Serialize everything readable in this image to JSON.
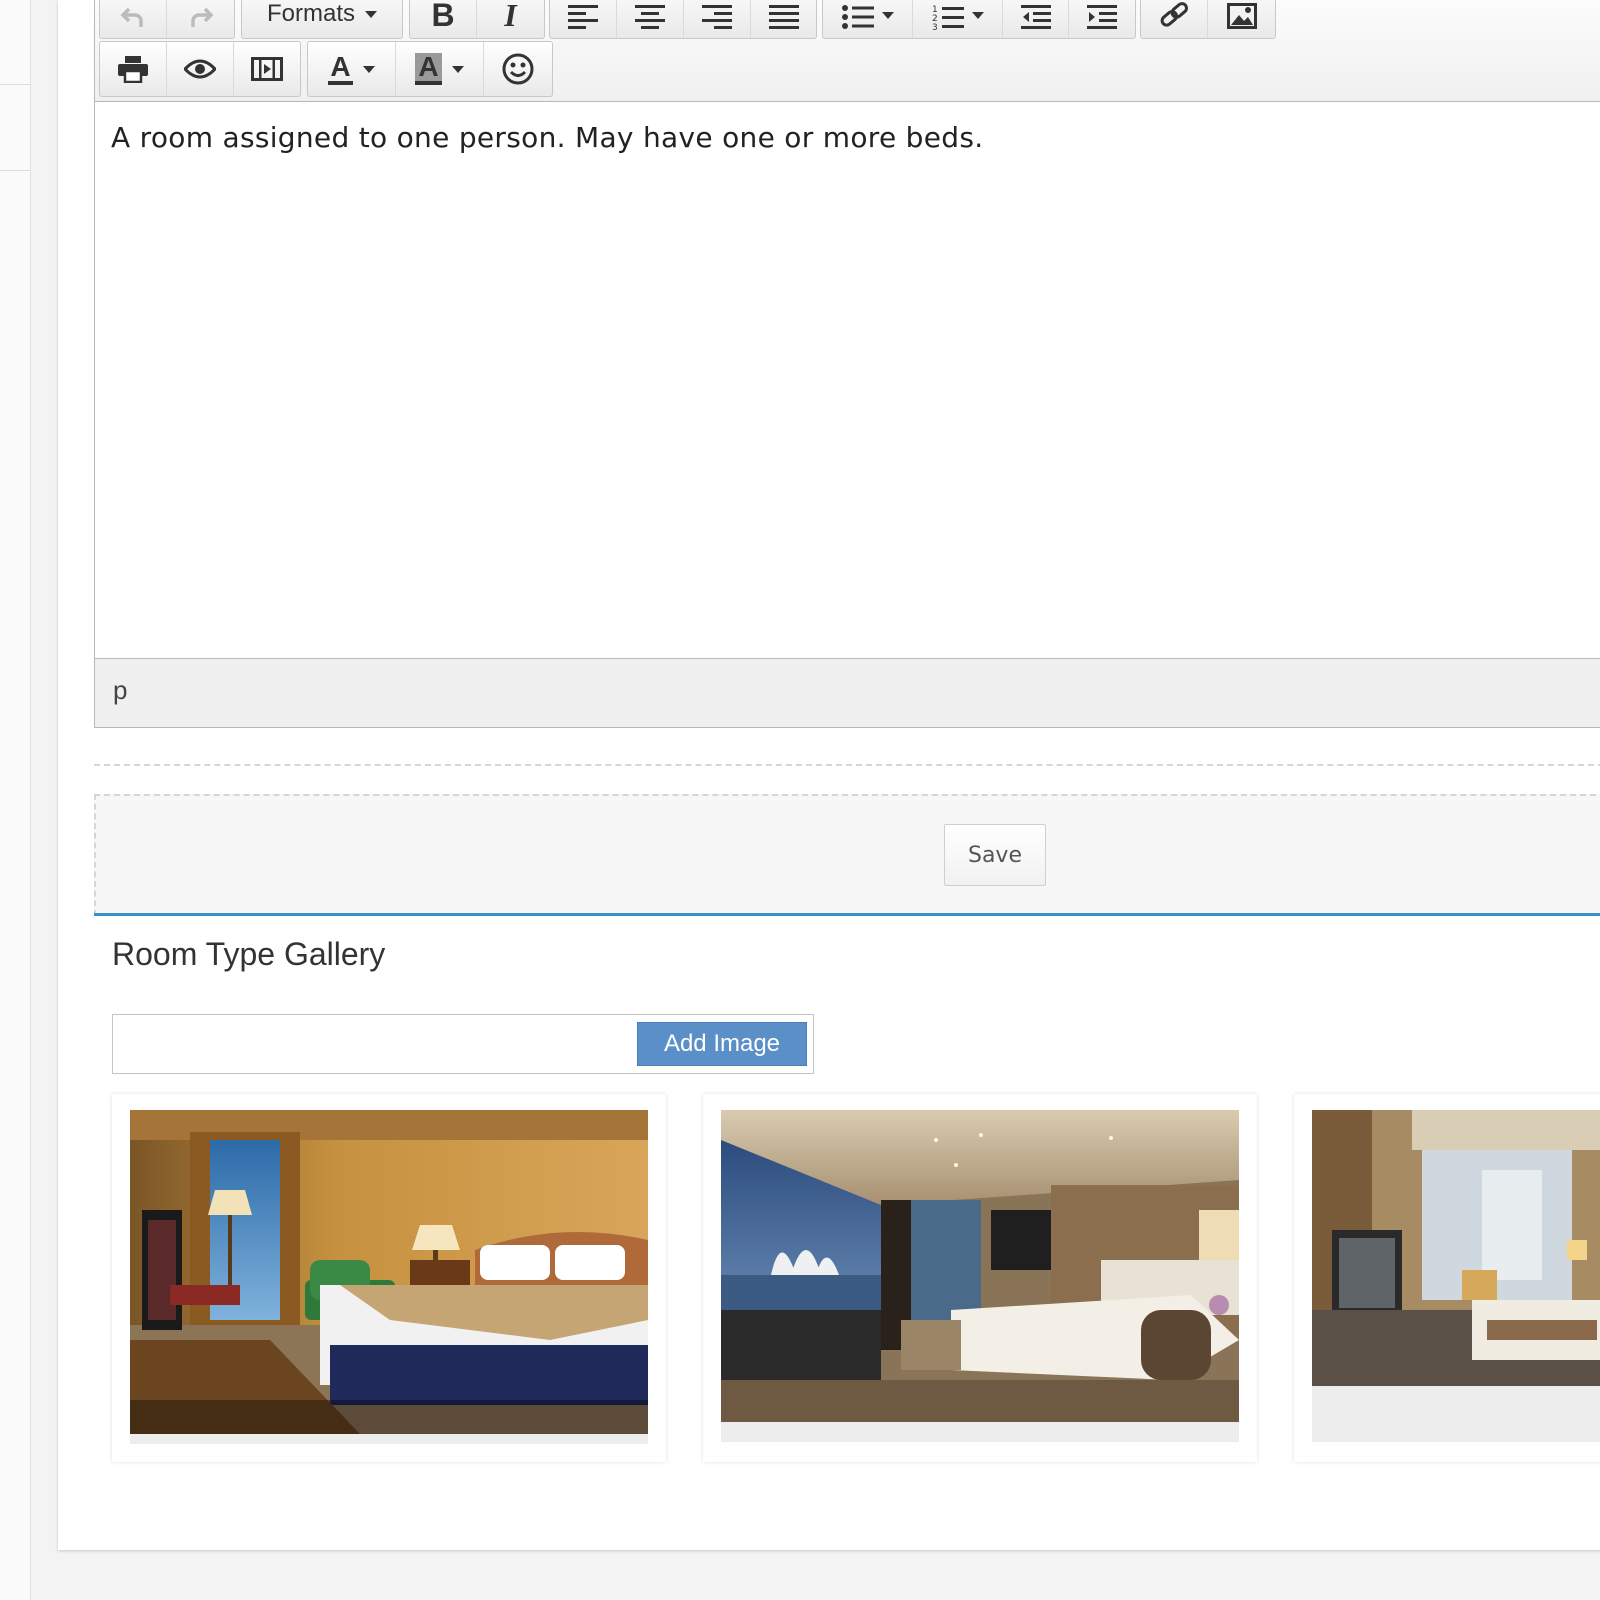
{
  "toolbar": {
    "undo": "undo-icon",
    "redo": "redo-icon",
    "formats_label": "Formats",
    "bold_label": "B",
    "italic_label": "I",
    "text_color_label": "A",
    "bg_color_label": "A"
  },
  "editor": {
    "content": "A room assigned to one person. May have one or more beds.",
    "path": "p"
  },
  "actions": {
    "save_label": "Save"
  },
  "gallery": {
    "title": "Room Type Gallery",
    "add_image_label": "Add Image",
    "add_image_value": ""
  },
  "colors": {
    "accent_blue": "#3a8fc6",
    "add_button": "#5b8fc8"
  }
}
